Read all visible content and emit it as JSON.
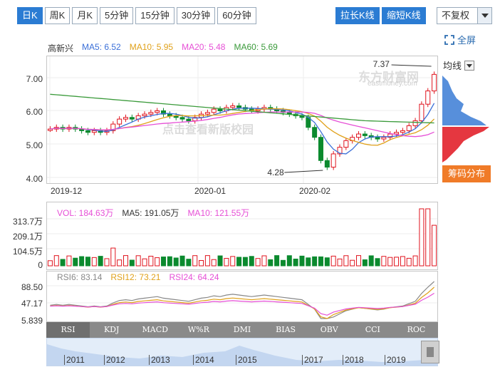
{
  "toolbar": {
    "periods": [
      "日K",
      "周K",
      "月K",
      "5分钟",
      "15分钟",
      "30分钟",
      "60分钟"
    ],
    "active_period": "日K",
    "stretch_label": "拉长K线",
    "shrink_label": "缩短K线",
    "adjust_label": "不复权",
    "fullscreen_label": "全屏"
  },
  "kline": {
    "stock_name": "高新兴",
    "ma": [
      {
        "label": "MA5: 6.52",
        "color": "#3a6fd8"
      },
      {
        "label": "MA10: 5.95",
        "color": "#e0a11a"
      },
      {
        "label": "MA20: 5.48",
        "color": "#e64fd6"
      },
      {
        "label": "MA60: 5.69",
        "color": "#3a9a3a"
      }
    ],
    "y_ticks": [
      "7.00",
      "6.00",
      "5.00",
      "4.00"
    ],
    "x_ticks": [
      "2019-12",
      "2020-01",
      "2020-02"
    ],
    "high_annotation": "7.37",
    "low_annotation": "4.28",
    "watermark_brand": "东方财富网",
    "watermark_url": "eastmoney.com",
    "watermark_center": "点击查看新版校园"
  },
  "volume": {
    "legend": [
      {
        "label": "VOL: 184.63万",
        "color": "#e64fd6"
      },
      {
        "label": "MA5: 191.05万",
        "color": "#333333"
      },
      {
        "label": "MA10: 121.55万",
        "color": "#e64fd6"
      }
    ],
    "y_ticks": [
      "313.7万",
      "209.1万",
      "104.5万",
      "0"
    ]
  },
  "rsi": {
    "legend": [
      {
        "label": "RSI6: 83.14",
        "color": "#888888"
      },
      {
        "label": "RSI12: 73.21",
        "color": "#e0a11a"
      },
      {
        "label": "RSI24: 64.24",
        "color": "#e64fd6"
      }
    ],
    "y_ticks": [
      "88.50",
      "47.17",
      "5.839"
    ]
  },
  "indicators": {
    "tabs": [
      "RSI",
      "KDJ",
      "MACD",
      "W%R",
      "DMI",
      "BIAS",
      "OBV",
      "CCI",
      "ROC"
    ],
    "active": "RSI"
  },
  "timeline": {
    "years": [
      "2011",
      "2012",
      "2013",
      "2014",
      "2015",
      "2017",
      "2018",
      "2019"
    ]
  },
  "distribution": {
    "mode_label": "均线",
    "button_label": "筹码分布"
  },
  "colors": {
    "up": "#e0141e",
    "down": "#0b8a2e",
    "accent": "#2b7cd3",
    "orange": "#f07b28"
  }
}
